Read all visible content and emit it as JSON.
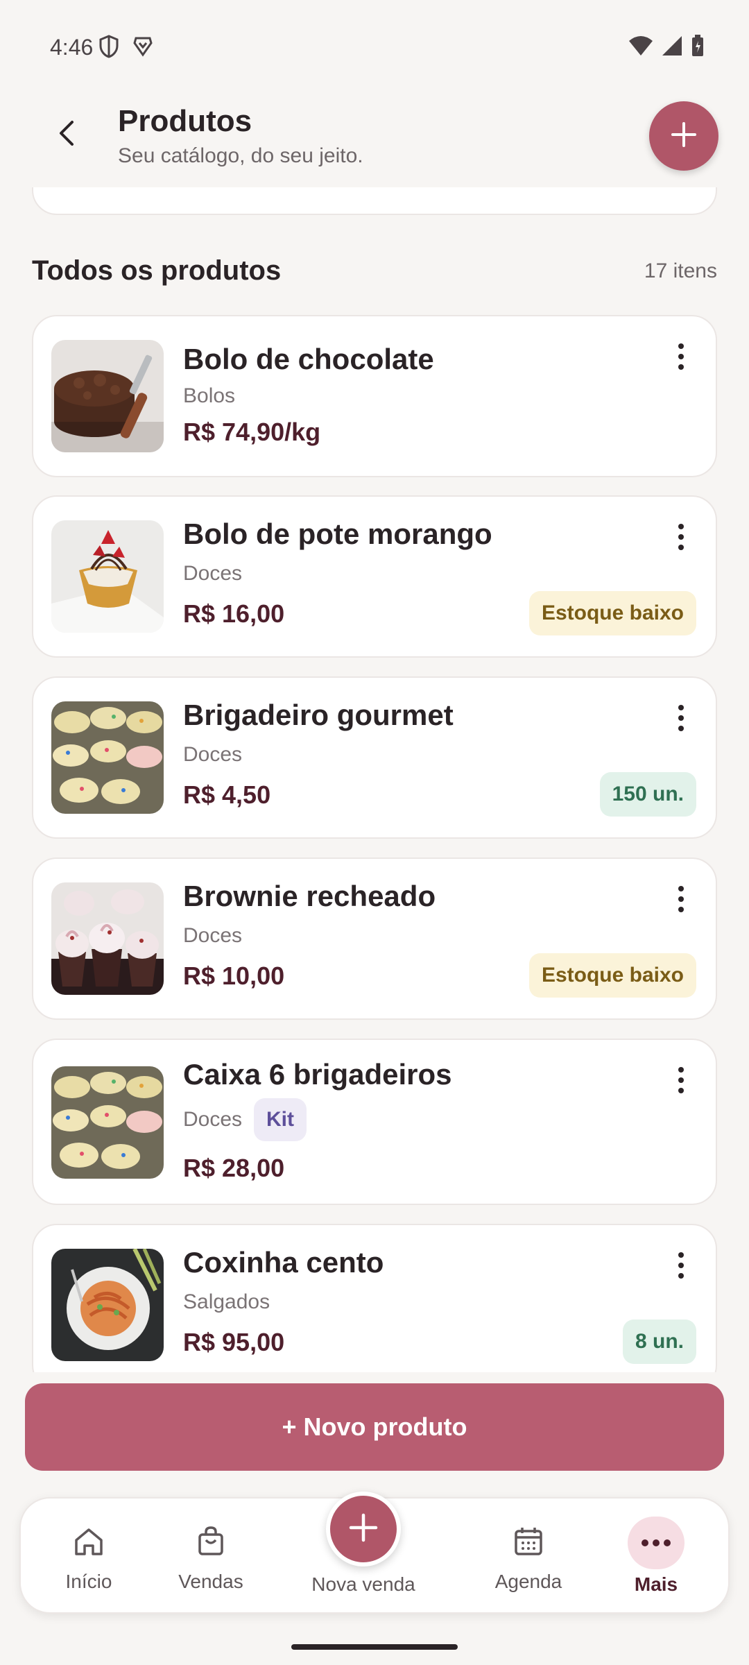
{
  "status_bar": {
    "time": "4:46"
  },
  "header": {
    "title": "Produtos",
    "subtitle": "Seu catálogo, do seu jeito."
  },
  "section": {
    "title": "Todos os produtos",
    "count": "17 itens"
  },
  "products": [
    {
      "name": "Bolo de chocolate",
      "category": "Bolos",
      "price": "R$ 74,90/kg",
      "badge": "",
      "badge_type": "",
      "kit": "",
      "image": "chocolate-cake"
    },
    {
      "name": "Bolo de pote morango",
      "category": "Doces",
      "price": "R$ 16,00",
      "badge": "Estoque baixo",
      "badge_type": "low",
      "kit": "",
      "image": "strawberry-tart"
    },
    {
      "name": "Brigadeiro gourmet",
      "category": "Doces",
      "price": "R$ 4,50",
      "badge": "150 un.",
      "badge_type": "ok",
      "kit": "",
      "image": "sprinkle-cupcakes"
    },
    {
      "name": "Brownie recheado",
      "category": "Doces",
      "price": "R$ 10,00",
      "badge": "Estoque baixo",
      "badge_type": "low",
      "kit": "",
      "image": "frosted-cupcakes"
    },
    {
      "name": "Caixa 6 brigadeiros",
      "category": "Doces",
      "price": "R$ 28,00",
      "badge": "",
      "badge_type": "",
      "kit": "Kit",
      "image": "sprinkle-cupcakes"
    },
    {
      "name": "Coxinha cento",
      "category": "Salgados",
      "price": "R$ 95,00",
      "badge": "8 un.",
      "badge_type": "ok",
      "kit": "",
      "image": "pasta-plate"
    }
  ],
  "actions": {
    "new_product": "+ Novo produto"
  },
  "bottom_nav": {
    "items": [
      {
        "label": "Início",
        "icon": "home-icon"
      },
      {
        "label": "Vendas",
        "icon": "shopping-bag-icon"
      },
      {
        "label": "Nova venda",
        "icon": "plus-icon"
      },
      {
        "label": "Agenda",
        "icon": "calendar-icon"
      },
      {
        "label": "Mais",
        "icon": "more-icon",
        "active": true
      }
    ]
  },
  "colors": {
    "accent": "#b05668",
    "price": "#4e1f2c",
    "background": "#f7f5f3",
    "badge_low_bg": "#fbf3d9",
    "badge_ok_bg": "#e2f2ea",
    "kit_bg": "#eeebf6"
  }
}
